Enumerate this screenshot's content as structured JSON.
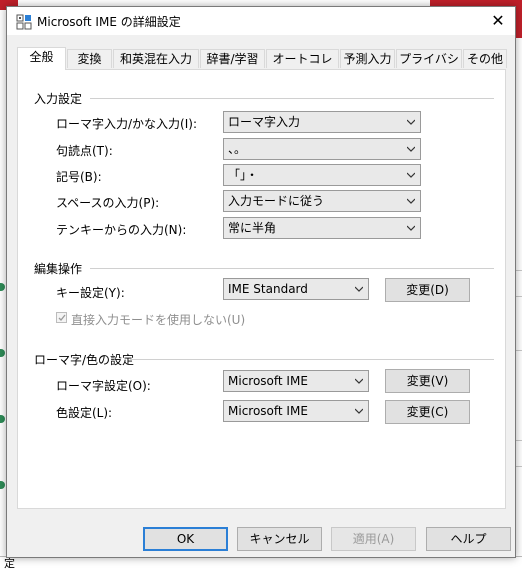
{
  "window": {
    "title": "Microsoft IME の詳細設定",
    "close_glyph": "✕"
  },
  "tabs": [
    {
      "label": "全般",
      "active": true
    },
    {
      "label": "変換"
    },
    {
      "label": "和英混在入力"
    },
    {
      "label": "辞書/学習"
    },
    {
      "label": "オートコレクト"
    },
    {
      "label": "予測入力"
    },
    {
      "label": "プライバシー"
    },
    {
      "label": "その他"
    }
  ],
  "input_settings": {
    "title": "入力設定",
    "rows": [
      {
        "label": "ローマ字入力/かな入力(I):",
        "value": "ローマ字入力"
      },
      {
        "label": "句読点(T):",
        "value": "、。"
      },
      {
        "label": "記号(B):",
        "value": "「」・"
      },
      {
        "label": "スペースの入力(P):",
        "value": "入力モードに従う"
      },
      {
        "label": "テンキーからの入力(N):",
        "value": "常に半角"
      }
    ]
  },
  "edit_ops": {
    "title": "編集操作",
    "key_label": "キー設定(Y):",
    "key_value": "IME Standard",
    "change_label": "変更(D)",
    "checkbox_label": "直接入力モードを使用しない(U)",
    "checkbox_checked": true
  },
  "roman_color": {
    "title": "ローマ字/色の設定",
    "roman_label": "ローマ字設定(O):",
    "roman_value": "Microsoft IME",
    "roman_change": "変更(V)",
    "color_label": "色設定(L):",
    "color_value": "Microsoft IME",
    "color_change": "変更(C)"
  },
  "footer": {
    "ok": "OK",
    "cancel": "キャンセル",
    "apply": "適用(A)",
    "help": "ヘルプ"
  },
  "background": {
    "bottom_text": "定"
  },
  "colors": {
    "accent": "#2b7fd6",
    "background_red": "#c0202a"
  }
}
